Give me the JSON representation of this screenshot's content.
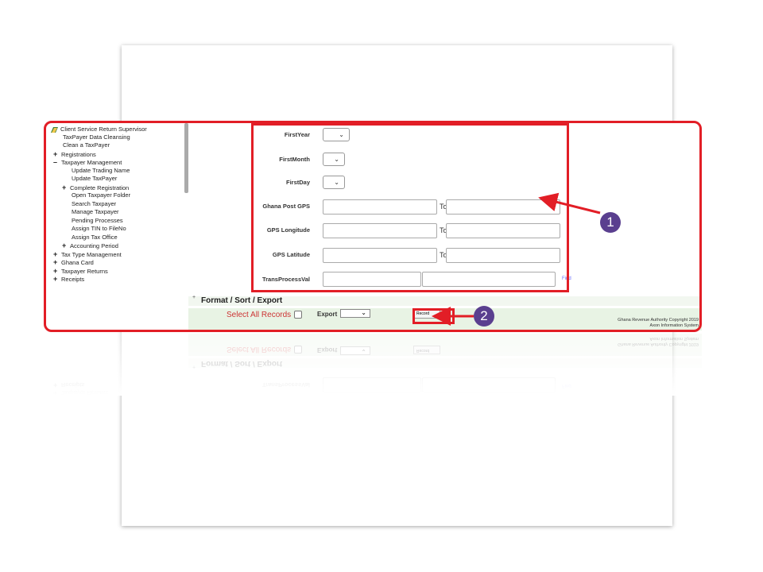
{
  "sidebar": {
    "items": [
      {
        "pm": "–",
        "label": "Client Service Return Supervisor",
        "indent": 0,
        "icon": "folder"
      },
      {
        "pm": "",
        "label": "TaxPayer Data Cleansing",
        "indent": 1
      },
      {
        "pm": "",
        "label": "Clean a TaxPayer",
        "indent": 1
      },
      {
        "pm": "+",
        "label": "Registrations",
        "indent": 1
      },
      {
        "pm": "–",
        "label": "Taxpayer Management",
        "indent": 1
      },
      {
        "pm": "",
        "label": "Update Trading Name",
        "indent": 2
      },
      {
        "pm": "",
        "label": "Update TaxPayer",
        "indent": 2
      },
      {
        "pm": "+",
        "label": "Complete Registration",
        "indent": 2
      },
      {
        "pm": "",
        "label": "Open Taxpayer Folder",
        "indent": 2
      },
      {
        "pm": "",
        "label": "Search Taxpayer",
        "indent": 2
      },
      {
        "pm": "",
        "label": "Manage Taxpayer",
        "indent": 2
      },
      {
        "pm": "",
        "label": "Pending Processes",
        "indent": 2
      },
      {
        "pm": "",
        "label": "Assign TIN to FileNo",
        "indent": 2
      },
      {
        "pm": "",
        "label": "Assign Tax Office",
        "indent": 2
      },
      {
        "pm": "+",
        "label": "Accounting Period",
        "indent": 2
      },
      {
        "pm": "+",
        "label": "Tax Type Management",
        "indent": 1
      },
      {
        "pm": "+",
        "label": "Ghana Card",
        "indent": 1
      },
      {
        "pm": "+",
        "label": "Taxpayer Returns",
        "indent": 1
      },
      {
        "pm": "+",
        "label": "Receipts",
        "indent": 1
      }
    ]
  },
  "form": {
    "first_year_label": "FirstYear",
    "first_month_label": "FirstMonth",
    "first_day_label": "FirstDay",
    "ghana_post_gps_label": "Ghana Post GPS",
    "gps_longitude_label": "GPS Longitude",
    "gps_latitude_label": "GPS Latitude",
    "trans_process_val_label": "TransProcessVal",
    "to_label": "To",
    "find_label": "Find"
  },
  "format_section": {
    "toggle": "+",
    "title": "Format / Sort / Export",
    "select_all_label": "Select All Records",
    "export_label": "Export",
    "record_button_label": "Record"
  },
  "footer": {
    "copyright": "Ghana Revenue Authority Copyright 2019",
    "company": "Axon Information System"
  },
  "callouts": {
    "badge_1": "1",
    "badge_2": "2"
  },
  "colors": {
    "highlight": "#e21e26",
    "badge": "#5a3f8f",
    "select_all_text": "#cc3333",
    "green_bar": "#e8f3e4"
  }
}
